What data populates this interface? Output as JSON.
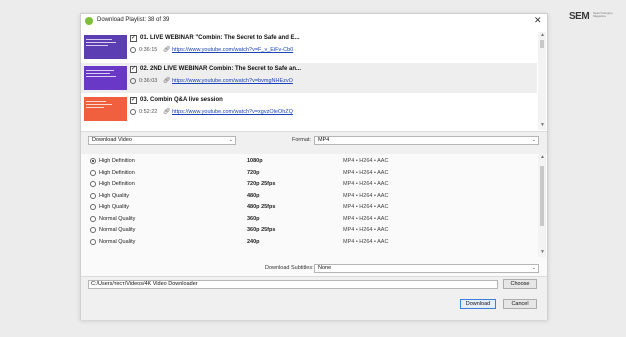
{
  "window": {
    "title": "Download Playlist: 38 of 39",
    "close_glyph": "✕"
  },
  "logo": {
    "main": "SEM",
    "sub": "Search Engine Magazine"
  },
  "playlist": [
    {
      "title": "01. LIVE WEBINAR \"Combin: The Secret to Safe and E...",
      "duration": "0:36:15",
      "url": "https://www.youtube.com/watch?v=F_v_EiFv-Cb0",
      "checked": true,
      "thumb_color": "#5b3fb2"
    },
    {
      "title": "02. 2ND LIVE WEBINAR Combin: The Secret to Safe an...",
      "duration": "0:36:03",
      "url": "https://www.youtube.com/watch?v=bvmgNHEzvO",
      "checked": true,
      "thumb_color": "#6a38c6"
    },
    {
      "title": "03. Combin Q&A live session",
      "duration": "0:52:22",
      "url": "https://www.youtube.com/watch?v=xgvzOleOhZQ",
      "checked": true,
      "thumb_color": "#f0603e"
    }
  ],
  "download_type": "Download Video",
  "format_label": "Format:",
  "format_value": "MP4",
  "qualities": [
    {
      "name": "High Definition",
      "res": "1080p",
      "fmt": "MP4 • H264 • AAC",
      "selected": true
    },
    {
      "name": "High Definition",
      "res": "720p",
      "fmt": "MP4 • H264 • AAC",
      "selected": false
    },
    {
      "name": "High Definition",
      "res": "720p 25fps",
      "fmt": "MP4 • H264 • AAC",
      "selected": false
    },
    {
      "name": "High Quality",
      "res": "480p",
      "fmt": "MP4 • H264 • AAC",
      "selected": false
    },
    {
      "name": "High Quality",
      "res": "480p 25fps",
      "fmt": "MP4 • H264 • AAC",
      "selected": false
    },
    {
      "name": "Normal Quality",
      "res": "360p",
      "fmt": "MP4 • H264 • AAC",
      "selected": false
    },
    {
      "name": "Normal Quality",
      "res": "360p 25fps",
      "fmt": "MP4 • H264 • AAC",
      "selected": false
    },
    {
      "name": "Normal Quality",
      "res": "240p",
      "fmt": "MP4 • H264 • AAC",
      "selected": false
    }
  ],
  "subtitles_label": "Download Subtitles:",
  "subtitles_value": "None",
  "path_value": "C:/Users/тест/Videos/4K Video Downloader",
  "choose_label": "Choose",
  "download_label": "Download",
  "cancel_label": "Cancel",
  "accent_color": "#3c7fd6"
}
